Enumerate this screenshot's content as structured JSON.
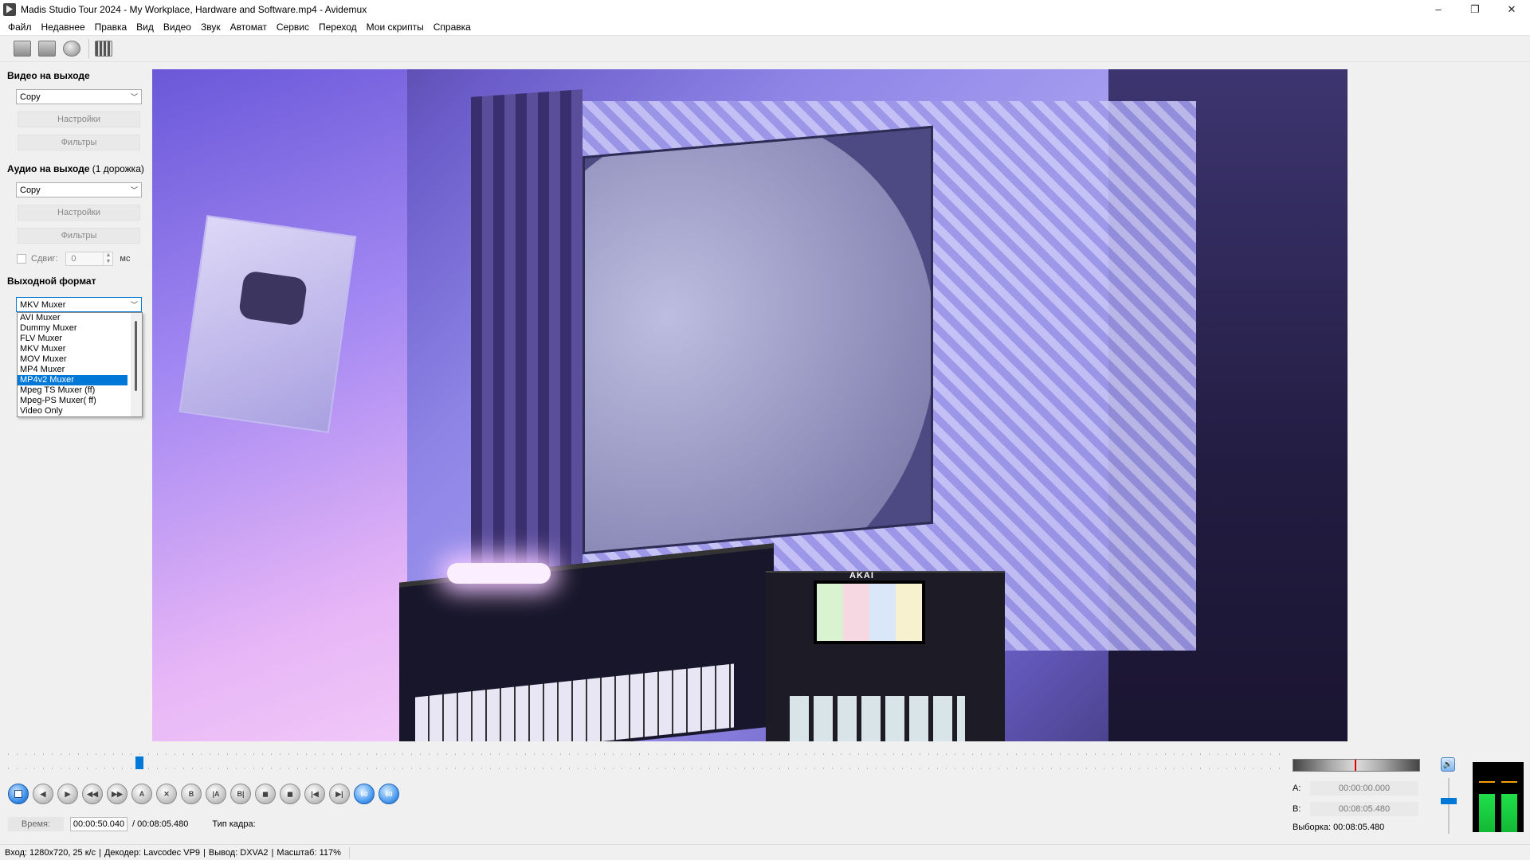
{
  "window": {
    "title": "Madis Studio Tour 2024 - My Workplace, Hardware and Software.mp4 - Avidemux",
    "controls": {
      "minimize": "–",
      "restore": "❐",
      "close": "✕"
    }
  },
  "menu": [
    "Файл",
    "Недавнее",
    "Правка",
    "Вид",
    "Видео",
    "Звук",
    "Автомат",
    "Сервис",
    "Переход",
    "Мои скрипты",
    "Справка"
  ],
  "toolbar": {
    "icons": [
      "open-image-icon",
      "save-icon",
      "info-icon",
      "film-icon"
    ]
  },
  "left_panel": {
    "video_output": {
      "title": "Видео на выходе",
      "codec": "Copy",
      "configure_label": "Настройки",
      "filters_label": "Фильтры"
    },
    "audio_output": {
      "title": "Аудио на выходе",
      "track_note": "(1 дорожка)",
      "codec": "Copy",
      "configure_label": "Настройки",
      "filters_label": "Фильтры",
      "shift_label": "Сдвиг:",
      "shift_value": "0",
      "shift_unit": "мс",
      "shift_checked": false
    },
    "output_format": {
      "title": "Выходной формат",
      "selected": "MKV Muxer",
      "highlighted": "MP4v2 Muxer",
      "options": [
        "AVI Muxer",
        "Dummy Muxer",
        "FLV Muxer",
        "MKV Muxer",
        "MOV Muxer",
        "MP4 Muxer",
        "MP4v2 Muxer",
        "Mpeg TS Muxer (ff)",
        "Mpeg-PS Muxer( ff)",
        "Video Only"
      ]
    }
  },
  "video": {
    "brand_text": "AKAI"
  },
  "timeline": {
    "position_fraction": 0.1
  },
  "transport": {
    "buttons": [
      {
        "name": "play-button",
        "label": "",
        "style": "play"
      },
      {
        "name": "rewind-button",
        "label": "◀"
      },
      {
        "name": "forward-button",
        "label": "▶"
      },
      {
        "name": "prev-keyframe-button",
        "label": "◀◀"
      },
      {
        "name": "next-keyframe-button",
        "label": "▶▶"
      },
      {
        "name": "set-marker-a-button",
        "label": "A"
      },
      {
        "name": "delete-button",
        "label": "✕"
      },
      {
        "name": "set-marker-b-button",
        "label": "B"
      },
      {
        "name": "goto-marker-a-button",
        "label": "|A"
      },
      {
        "name": "goto-marker-b-button",
        "label": "B|"
      },
      {
        "name": "prev-black-frame-button",
        "label": "◼"
      },
      {
        "name": "next-black-frame-button",
        "label": "◼"
      },
      {
        "name": "first-frame-button",
        "label": "|◀"
      },
      {
        "name": "last-frame-button",
        "label": "▶|"
      },
      {
        "name": "back-60-button",
        "label": "60",
        "style": "blue"
      },
      {
        "name": "forward-60-button",
        "label": "60",
        "style": "blue"
      }
    ]
  },
  "time": {
    "label": "Время:",
    "current": "00:00:50.040",
    "total": "/ 00:08:05.480",
    "frame_type_label": "Тип кадра:"
  },
  "ab": {
    "a_label": "A:",
    "a_value": "00:00:00.000",
    "b_label": "B:",
    "b_value": "00:08:05.480",
    "selection": "Выборка: 00:08:05.480"
  },
  "volume": {
    "level_fraction": 0.65
  },
  "meter": {
    "left_level": 0.55,
    "right_level": 0.55
  },
  "status": {
    "input": "Вход: 1280x720, 25 к/с",
    "decoder": "Декодер: Lavcodec VP9",
    "output": "Вывод: DXVA2",
    "zoom": "Масштаб: 117%"
  },
  "colors": {
    "accent": "#0078d7",
    "meter_green": "#1fe04a"
  }
}
